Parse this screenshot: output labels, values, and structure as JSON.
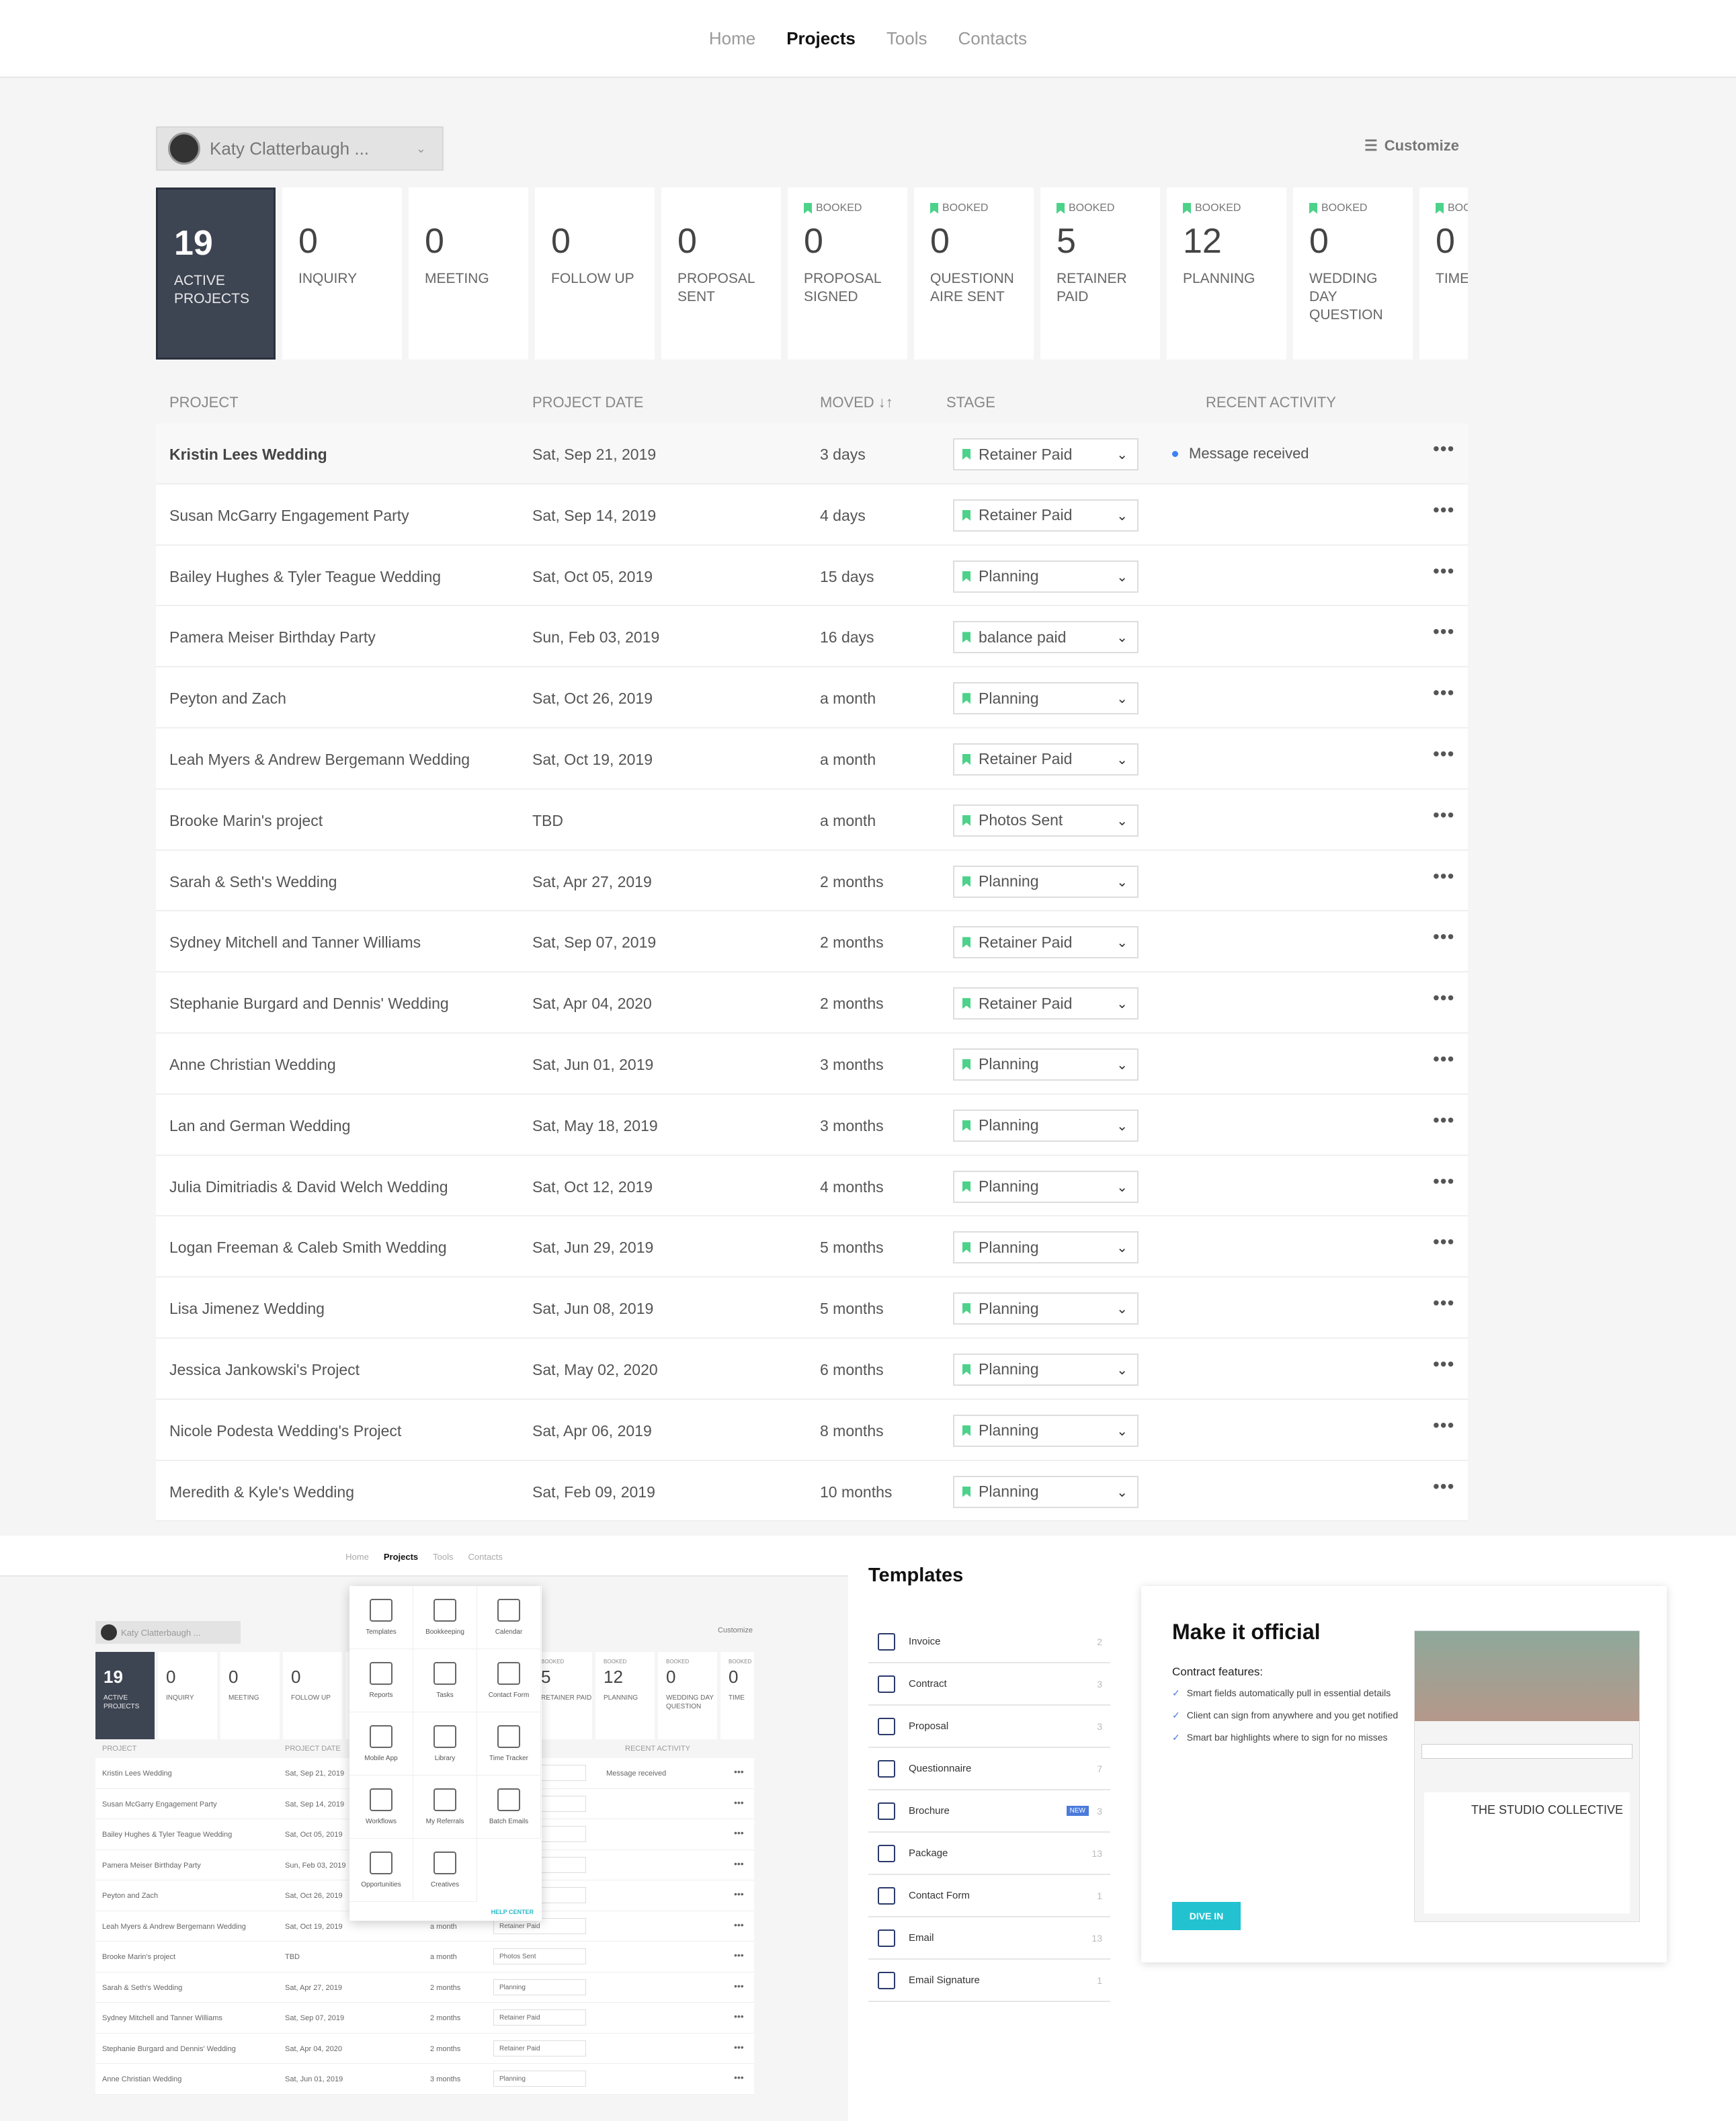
{
  "nav": {
    "items": [
      "Home",
      "Projects",
      "Tools",
      "Contacts"
    ],
    "active": "Projects"
  },
  "user": {
    "name": "Katy Clatterbaugh ..."
  },
  "customize": "Customize",
  "booked_label": "BOOKED",
  "stats": [
    {
      "num": "19",
      "label": "ACTIVE PROJECTS",
      "booked": false
    },
    {
      "num": "0",
      "label": "INQUIRY",
      "booked": false
    },
    {
      "num": "0",
      "label": "MEETING",
      "booked": false
    },
    {
      "num": "0",
      "label": "FOLLOW UP",
      "booked": false
    },
    {
      "num": "0",
      "label": "PROPOSAL SENT",
      "booked": false
    },
    {
      "num": "0",
      "label": "PROPOSAL SIGNED",
      "booked": true
    },
    {
      "num": "0",
      "label": "QUESTIONN AIRE SENT",
      "booked": true
    },
    {
      "num": "5",
      "label": "RETAINER PAID",
      "booked": true
    },
    {
      "num": "12",
      "label": "PLANNING",
      "booked": true
    },
    {
      "num": "0",
      "label": "WEDDING DAY QUESTION",
      "booked": true
    },
    {
      "num": "0",
      "label": "TIME",
      "booked": true
    }
  ],
  "table": {
    "headers": {
      "project": "PROJECT",
      "date": "PROJECT DATE",
      "moved": "MOVED ↓↑",
      "stage": "STAGE",
      "activity": "RECENT ACTIVITY"
    },
    "rows": [
      {
        "name": "Kristin Lees Wedding",
        "date": "Sat, Sep 21, 2019",
        "moved": "3 days",
        "stage": "Retainer Paid",
        "activity": "Message received"
      },
      {
        "name": "Susan McGarry Engagement Party",
        "date": "Sat, Sep 14, 2019",
        "moved": "4 days",
        "stage": "Retainer Paid",
        "activity": ""
      },
      {
        "name": "Bailey Hughes & Tyler Teague Wedding",
        "date": "Sat, Oct 05, 2019",
        "moved": "15 days",
        "stage": "Planning",
        "activity": ""
      },
      {
        "name": "Pamera Meiser Birthday Party",
        "date": "Sun, Feb 03, 2019",
        "moved": "16 days",
        "stage": "balance paid",
        "activity": ""
      },
      {
        "name": "Peyton and Zach",
        "date": "Sat, Oct 26, 2019",
        "moved": "a month",
        "stage": "Planning",
        "activity": ""
      },
      {
        "name": "Leah Myers & Andrew Bergemann Wedding",
        "date": "Sat, Oct 19, 2019",
        "moved": "a month",
        "stage": "Retainer Paid",
        "activity": ""
      },
      {
        "name": "Brooke Marin's project",
        "date": "TBD",
        "moved": "a month",
        "stage": "Photos Sent",
        "activity": ""
      },
      {
        "name": "Sarah & Seth's Wedding",
        "date": "Sat, Apr 27, 2019",
        "moved": "2 months",
        "stage": "Planning",
        "activity": ""
      },
      {
        "name": "Sydney Mitchell and Tanner Williams",
        "date": "Sat, Sep 07, 2019",
        "moved": "2 months",
        "stage": "Retainer Paid",
        "activity": ""
      },
      {
        "name": "Stephanie Burgard and Dennis' Wedding",
        "date": "Sat, Apr 04, 2020",
        "moved": "2 months",
        "stage": "Retainer Paid",
        "activity": ""
      },
      {
        "name": "Anne Christian Wedding",
        "date": "Sat, Jun 01, 2019",
        "moved": "3 months",
        "stage": "Planning",
        "activity": ""
      },
      {
        "name": "Lan and German Wedding",
        "date": "Sat, May 18, 2019",
        "moved": "3 months",
        "stage": "Planning",
        "activity": ""
      },
      {
        "name": "Julia Dimitriadis & David Welch Wedding",
        "date": "Sat, Oct 12, 2019",
        "moved": "4 months",
        "stage": "Planning",
        "activity": ""
      },
      {
        "name": "Logan Freeman & Caleb Smith Wedding",
        "date": "Sat, Jun 29, 2019",
        "moved": "5 months",
        "stage": "Planning",
        "activity": ""
      },
      {
        "name": "Lisa Jimenez Wedding",
        "date": "Sat, Jun 08, 2019",
        "moved": "5 months",
        "stage": "Planning",
        "activity": ""
      },
      {
        "name": "Jessica Jankowski's Project",
        "date": "Sat, May 02, 2020",
        "moved": "6 months",
        "stage": "Planning",
        "activity": ""
      },
      {
        "name": "Nicole Podesta Wedding's Project",
        "date": "Sat, Apr 06, 2019",
        "moved": "8 months",
        "stage": "Planning",
        "activity": ""
      },
      {
        "name": "Meredith & Kyle's Wedding",
        "date": "Sat, Feb 09, 2019",
        "moved": "10 months",
        "stage": "Planning",
        "activity": ""
      }
    ]
  },
  "tools_menu": {
    "items": [
      "Templates",
      "Bookkeeping",
      "Calendar",
      "Reports",
      "Tasks",
      "Contact Form",
      "Mobile App",
      "Library",
      "Time Tracker",
      "Workflows",
      "My Referrals",
      "Batch Emails",
      "Opportunities",
      "Creatives"
    ],
    "help": "HELP CENTER"
  },
  "templates": {
    "title": "Templates",
    "items": [
      {
        "label": "Invoice",
        "count": "2",
        "new": false
      },
      {
        "label": "Contract",
        "count": "3",
        "new": false
      },
      {
        "label": "Proposal",
        "count": "3",
        "new": false
      },
      {
        "label": "Questionnaire",
        "count": "7",
        "new": false
      },
      {
        "label": "Brochure",
        "count": "3",
        "new": true
      },
      {
        "label": "Package",
        "count": "13",
        "new": false
      },
      {
        "label": "Contact Form",
        "count": "1",
        "new": false
      },
      {
        "label": "Email",
        "count": "13",
        "new": false
      },
      {
        "label": "Email Signature",
        "count": "1",
        "new": false
      }
    ],
    "new_badge": "NEW",
    "card": {
      "title": "Make it official",
      "subtitle": "Contract features:",
      "features": [
        "Smart fields automatically pull in essential details",
        "Client can sign from anywhere and you get notified",
        "Smart bar highlights where to sign for no misses"
      ],
      "button": "DIVE IN",
      "brand": "THE STUDIO COLLECTIVE"
    }
  },
  "colors": {
    "accent": "#4cd28a",
    "dark": "#3d4452",
    "teal": "#22c2d1",
    "blue": "#4a7bdc"
  }
}
